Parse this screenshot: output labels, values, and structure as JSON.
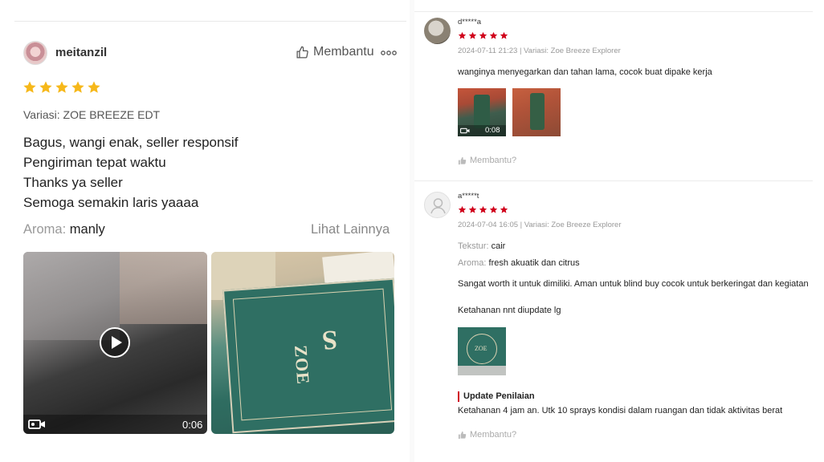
{
  "colors": {
    "star_gold": "#f6b81a",
    "star_red": "#d0011b",
    "update_accent": "#d0011b"
  },
  "left_review": {
    "username": "meitanzil",
    "avatar_icon": "avatar",
    "helpful_label": "Membantu",
    "more_icon": "more-dots-icon",
    "rating": 5,
    "variant": "Variasi: ZOE BREEZE EDT",
    "lines": [
      "Bagus, wangi enak, seller responsif",
      "Pengiriman tepat waktu",
      "Thanks ya seller",
      "Semoga semakin laris yaaaa"
    ],
    "aroma_label": "Aroma:",
    "aroma_value": "manly",
    "see_more": "Lihat Lainnya",
    "video_duration": "0:06"
  },
  "right_reviews": [
    {
      "username": "d*****a",
      "rating": 5,
      "meta": "2024-07-11 21:23 | Variasi: Zoe Breeze Explorer",
      "text": "wanginya menyegarkan dan tahan lama, cocok buat dipake kerja",
      "video_duration": "0:08",
      "helpful_label": "Membantu?"
    },
    {
      "username": "a*****t",
      "rating": 5,
      "meta": "2024-07-04 16:05 | Variasi: Zoe Breeze Explorer",
      "tekstur_label": "Tekstur:",
      "tekstur_value": "cair",
      "aroma_label": "Aroma:",
      "aroma_value": "fresh akuatik dan citrus",
      "text1": "Sangat worth it untuk dimiliki. Aman untuk blind buy cocok untuk berkeringat dan kegiatan",
      "text2": "Ketahanan nnt diupdate lg",
      "update_title": "Update Penilaian",
      "update_text": "Ketahanan 4 jam an. Utk 10 sprays kondisi dalam ruangan dan tidak aktivitas berat",
      "helpful_label": "Membantu?"
    }
  ]
}
